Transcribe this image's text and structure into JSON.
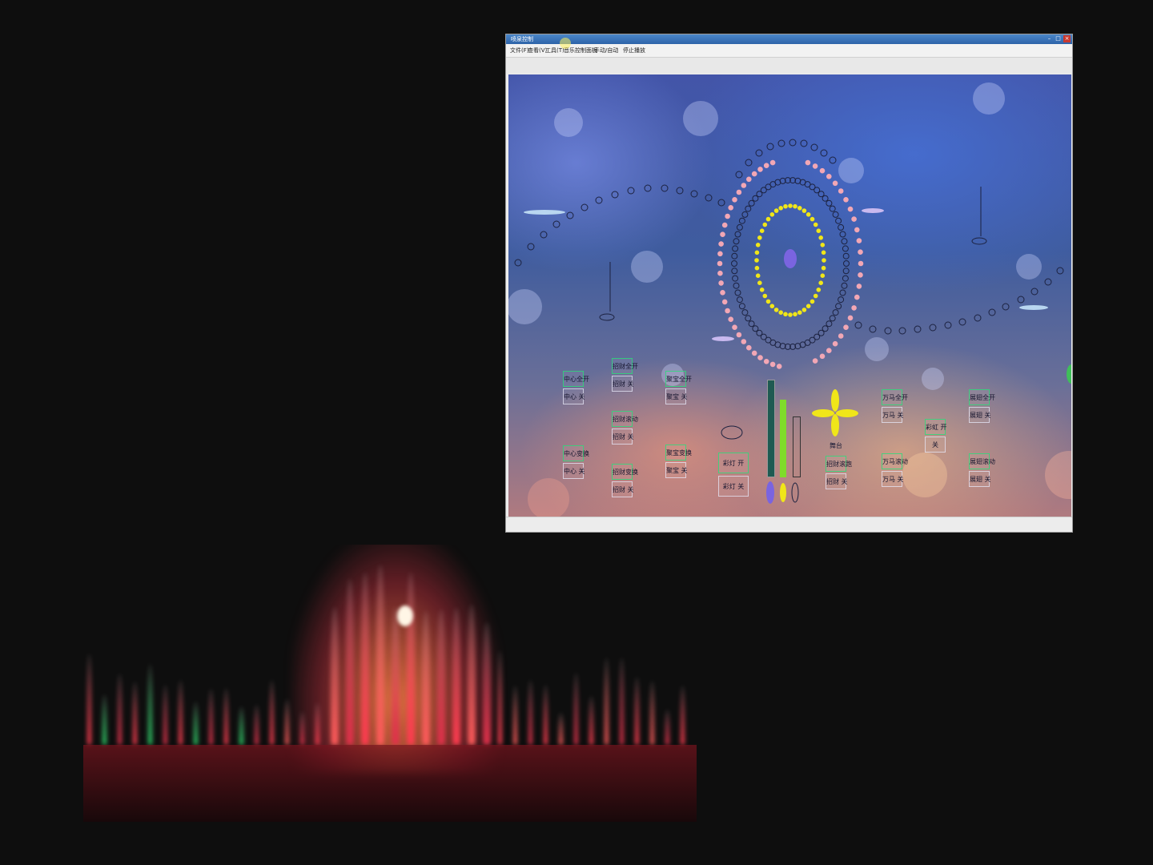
{
  "window": {
    "title": "喷泉控制",
    "menu": [
      {
        "label": "文件(F)"
      },
      {
        "label": "查看(V)"
      },
      {
        "label": "工具(T)"
      },
      {
        "label": "音乐控制面板"
      },
      {
        "label": "手动/自动"
      },
      {
        "label": "停止播放"
      }
    ]
  },
  "controls": {
    "center_all_on": "中心全开",
    "center_off_1": "中心 关",
    "center_change": "中心变换",
    "center_off_2": "中心 关",
    "zhaocai_all_on": "招财全开",
    "zhaocai_off_1": "招财 关",
    "zhaocai_move": "招财滚动",
    "zhaocai_off_2": "招财 关",
    "zhaocai_change": "招财变换",
    "zhaocai_off_3": "招财 关",
    "jubao_all_on": "聚宝全开",
    "jubao_off_1": "聚宝 关",
    "jubao_change": "聚宝变换",
    "jubao_off_2": "聚宝 关",
    "light_on": "彩灯 开",
    "light_off": "彩灯 关",
    "stage_label": "舞台",
    "zhaocai_roll": "招财滚跑",
    "zhaocai_off_4": "招财 关",
    "wanma_all_on": "万马全开",
    "wanma_off_1": "万马 关",
    "wanma_move": "万马滚动",
    "wanma_off_2": "万马 关",
    "caideng_on": "彩虹 开",
    "caideng_off": "关",
    "zhanchi_all_on": "展翅全开",
    "zhanchi_off_1": "展翅 关",
    "zhanchi_move": "展翅滚动",
    "zhanchi_off_2": "展翅 关"
  },
  "level_bars": [
    {
      "name": "dark-teal",
      "level": 0.97,
      "color": "#1f5a52"
    },
    {
      "name": "green",
      "level": 0.78,
      "color": "#7fdc2a"
    },
    {
      "name": "empty",
      "level": 0.6,
      "color": "transparent"
    }
  ],
  "colors": {
    "ring_yellow": "#f0e619",
    "dot_pink": "#f2a7b5",
    "center_purple": "#7a64e0",
    "button_border": "#28dc78"
  },
  "icons": [
    "minimize-icon",
    "maximize-icon",
    "close-icon",
    "clover-icon"
  ]
}
